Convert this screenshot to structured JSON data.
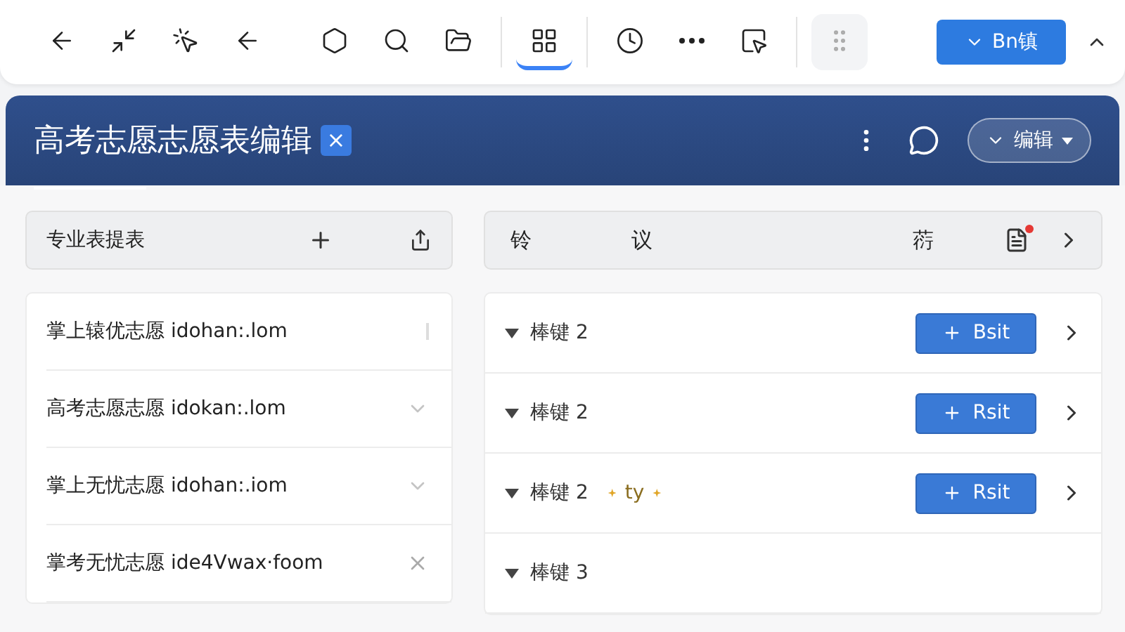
{
  "toolbar": {
    "items": [
      {
        "selected": false
      },
      {
        "selected": false
      },
      {
        "selected": false
      },
      {
        "selected": false
      },
      {
        "selected": false
      },
      {
        "selected": false
      },
      {
        "selected": false
      },
      {
        "selected": true
      },
      {
        "selected": false
      },
      {
        "selected": false
      },
      {
        "selected": false
      },
      {
        "selected": false
      }
    ],
    "button": {
      "label": "Bn镇"
    }
  },
  "header": {
    "title": "高考志愿志愿表编辑",
    "close_label": "×",
    "menu_button": {
      "label": "编辑"
    }
  },
  "left_panel": {
    "title": "专业表提表",
    "items": [
      {
        "label": "掌上辕优志愿 idohan:.lom",
        "kind": "bar"
      },
      {
        "label": "高考志愿志愿 idokan:.lom",
        "kind": "chevron"
      },
      {
        "label": "掌上无忧志愿 idohan:.iom",
        "kind": "chevron"
      },
      {
        "label": "掌考无忧志愿 ide4Vwax·foom",
        "kind": "close"
      }
    ]
  },
  "right_panel": {
    "columns": [
      "铃",
      "议",
      "葕"
    ],
    "rows": [
      {
        "label": "棒键 2",
        "expanded": true,
        "button": "Bsit"
      },
      {
        "label": "棒键 2",
        "expanded": true,
        "button": "Rsit"
      },
      {
        "label": "棒键 2",
        "expanded": true,
        "tag": "ty",
        "button": "Rsit"
      },
      {
        "label": "棒键 3",
        "expanded": true
      }
    ]
  }
}
